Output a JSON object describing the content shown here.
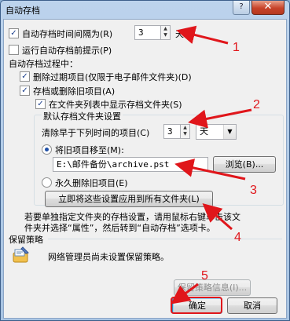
{
  "window": {
    "title": "自动存档",
    "help_label": "?",
    "close_label": "✕"
  },
  "options": {
    "autoarchive_every_label": "自动存档时间间隔为(R)",
    "autoarchive_days_value": "3",
    "autoarchive_days_unit": "天",
    "prompt_label": "运行自动存档前提示(P)",
    "during_label": "自动存档过程中：",
    "delete_expired_label": "删除过期项目(仅限于电子邮件文件夹)(D)",
    "archive_or_delete_label": "存档或删除旧项目(A)",
    "show_folder_label": "在文件夹列表中显示存档文件夹(S)",
    "default_folder_group": "默认存档文件夹设置",
    "clean_older_label": "清除早于下列时间的项目(C)",
    "clean_older_value": "3",
    "clean_older_unit": "天",
    "move_old_label": "将旧项目移至(M):",
    "archive_path": "E:\\邮件备份\\archive.pst",
    "browse_label": "浏览(B)...",
    "permanent_delete_label": "永久删除旧项目(E)",
    "apply_all_label": "立即将这些设置应用到所有文件夹(L)",
    "info_text_line1": "若要单独指定文件夹的存档设置，请用鼠标右键单击该文",
    "info_text_line2": "件夹并选择“属性”，然后转到“自动存档”选项卡。"
  },
  "retention": {
    "header": "保留策略",
    "message": "网络管理员尚未设置保留策略。",
    "info_button_label": "保留策略信息(I)..."
  },
  "footer": {
    "ok_label": "确定",
    "cancel_label": "取消"
  },
  "annotations": [
    "1",
    "2",
    "3",
    "4",
    "5"
  ],
  "colors": {
    "annotation": "#e0161b",
    "titlebar": "#bcd3ec"
  }
}
